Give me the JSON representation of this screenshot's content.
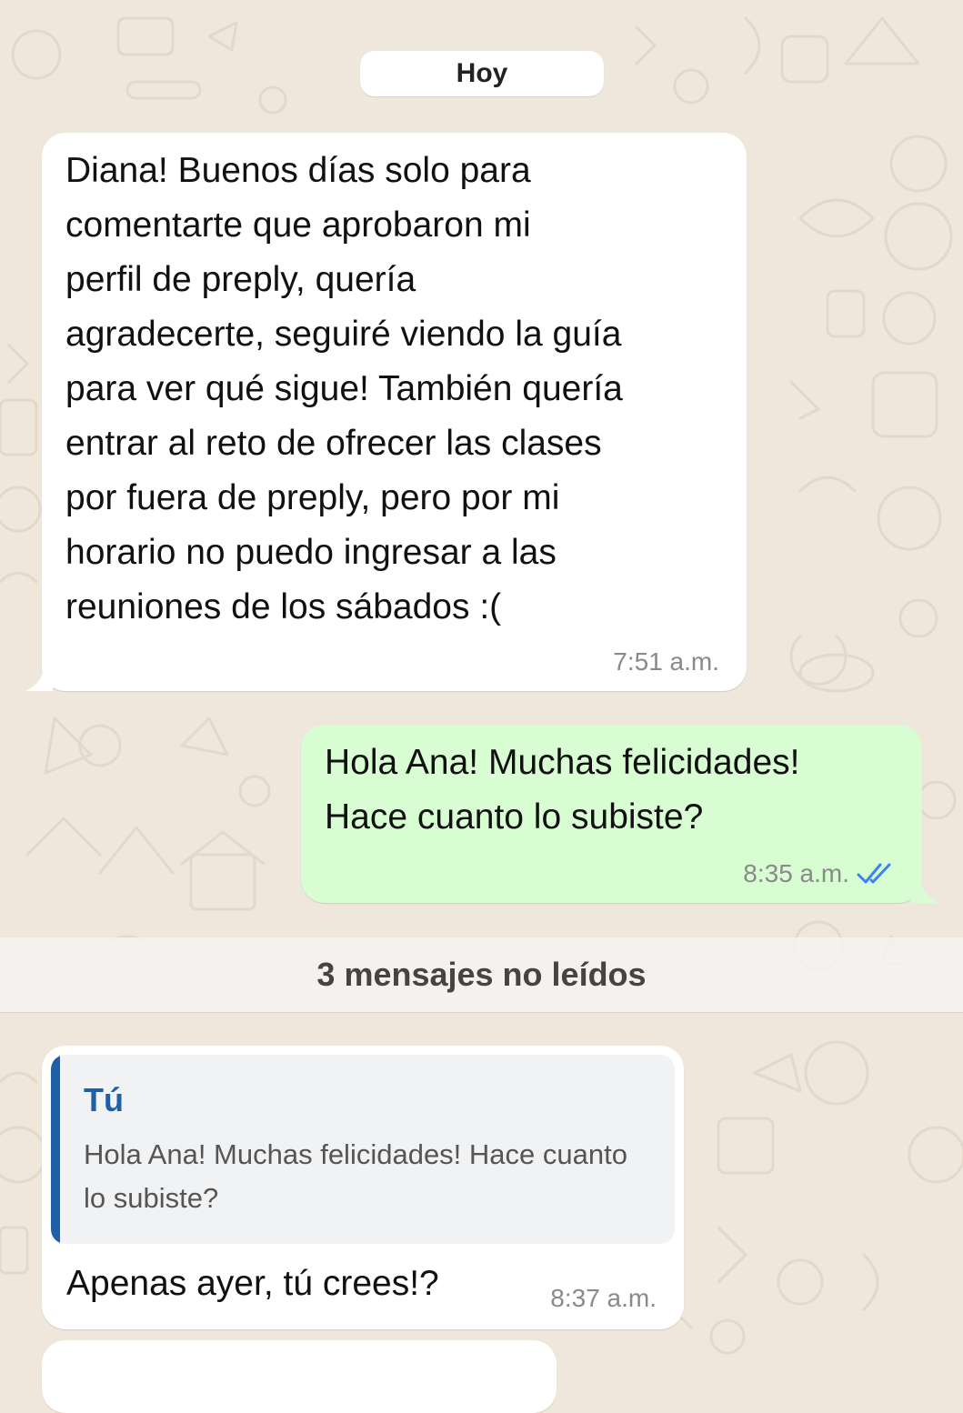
{
  "date_separator": "Hoy",
  "messages": [
    {
      "direction": "incoming",
      "text": "Diana! Buenos días solo para\ncomentarte que aprobaron mi\nperfil de preply, quería\nagradecerte, seguiré viendo la guía\npara ver qué sigue! También quería\nentrar al reto de ofrecer las clases\npor fuera de preply, pero por mi\nhorario no puedo ingresar a las\nreuniones de los sábados :(",
      "time": "7:51 a.m."
    },
    {
      "direction": "outgoing",
      "text": "Hola Ana! Muchas felicidades!\nHace cuanto lo subiste?",
      "time": "8:35 a.m.",
      "status_icon": "double-check-read-icon"
    }
  ],
  "unread_banner": "3 mensajes no leídos",
  "reply_message": {
    "direction": "incoming",
    "quote": {
      "author": "Tú",
      "text": "Hola Ana! Muchas felicidades! Hace cuanto lo subiste?"
    },
    "text": "Apenas ayer, tú crees!?",
    "time": "8:37 a.m."
  },
  "colors": {
    "wallpaper": "#efe7dc",
    "incoming_bubble": "#ffffff",
    "outgoing_bubble": "#d9fdd3",
    "quote_accent": "#1f5fa8",
    "read_ticks": "#3b82f6"
  }
}
